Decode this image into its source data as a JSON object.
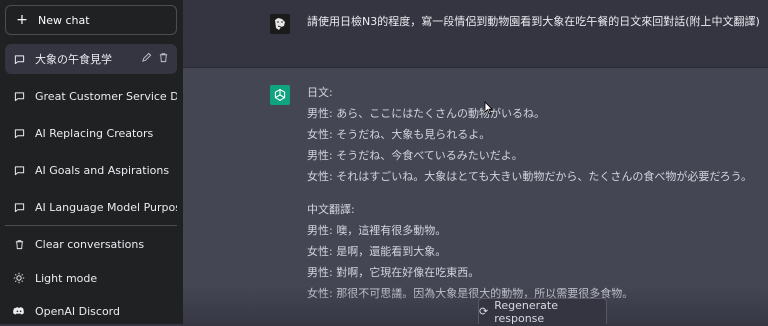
{
  "sidebar": {
    "new_chat": "New chat",
    "conversations": [
      {
        "label": "大象の午食見学",
        "active": true
      },
      {
        "label": "Great Customer Service Defi",
        "active": false
      },
      {
        "label": "AI Replacing Creators",
        "active": false
      },
      {
        "label": "AI Goals and Aspirations",
        "active": false
      },
      {
        "label": "AI Language Model Purpose",
        "active": false
      }
    ],
    "footer": {
      "clear": "Clear conversations",
      "light_mode": "Light mode",
      "discord": "OpenAI Discord"
    }
  },
  "chat": {
    "user_message": "請使用日檢N3的程度，寫一段情侶到動物園看到大象在吃午餐的日文來回對話(附上中文翻譯)",
    "assistant": {
      "jp_heading": "日文:",
      "jp_lines": [
        "男性: あら、ここにはたくさんの動物がいるね。",
        "女性: そうだね、大象も見られるよ。",
        "男性: そうだね、今食べているみたいだよ。",
        "女性: それはすごいね。大象はとても大きい動物だから、たくさんの食べ物が必要だろう。"
      ],
      "zh_heading": "中文翻譯:",
      "zh_lines": [
        "男性: 噢，這裡有很多動物。",
        "女性: 是啊，還能看到大象。",
        "男性: 對啊，它現在好像在吃東西。",
        "女性: 那很不可思議。因為大象是很大的動物，所以需要很多食物。"
      ]
    },
    "regenerate": "Regenerate response"
  },
  "colors": {
    "sidebar_bg": "#202123",
    "user_row_bg": "#343541",
    "assistant_row_bg": "#444654",
    "bot_avatar": "#10a37f"
  }
}
